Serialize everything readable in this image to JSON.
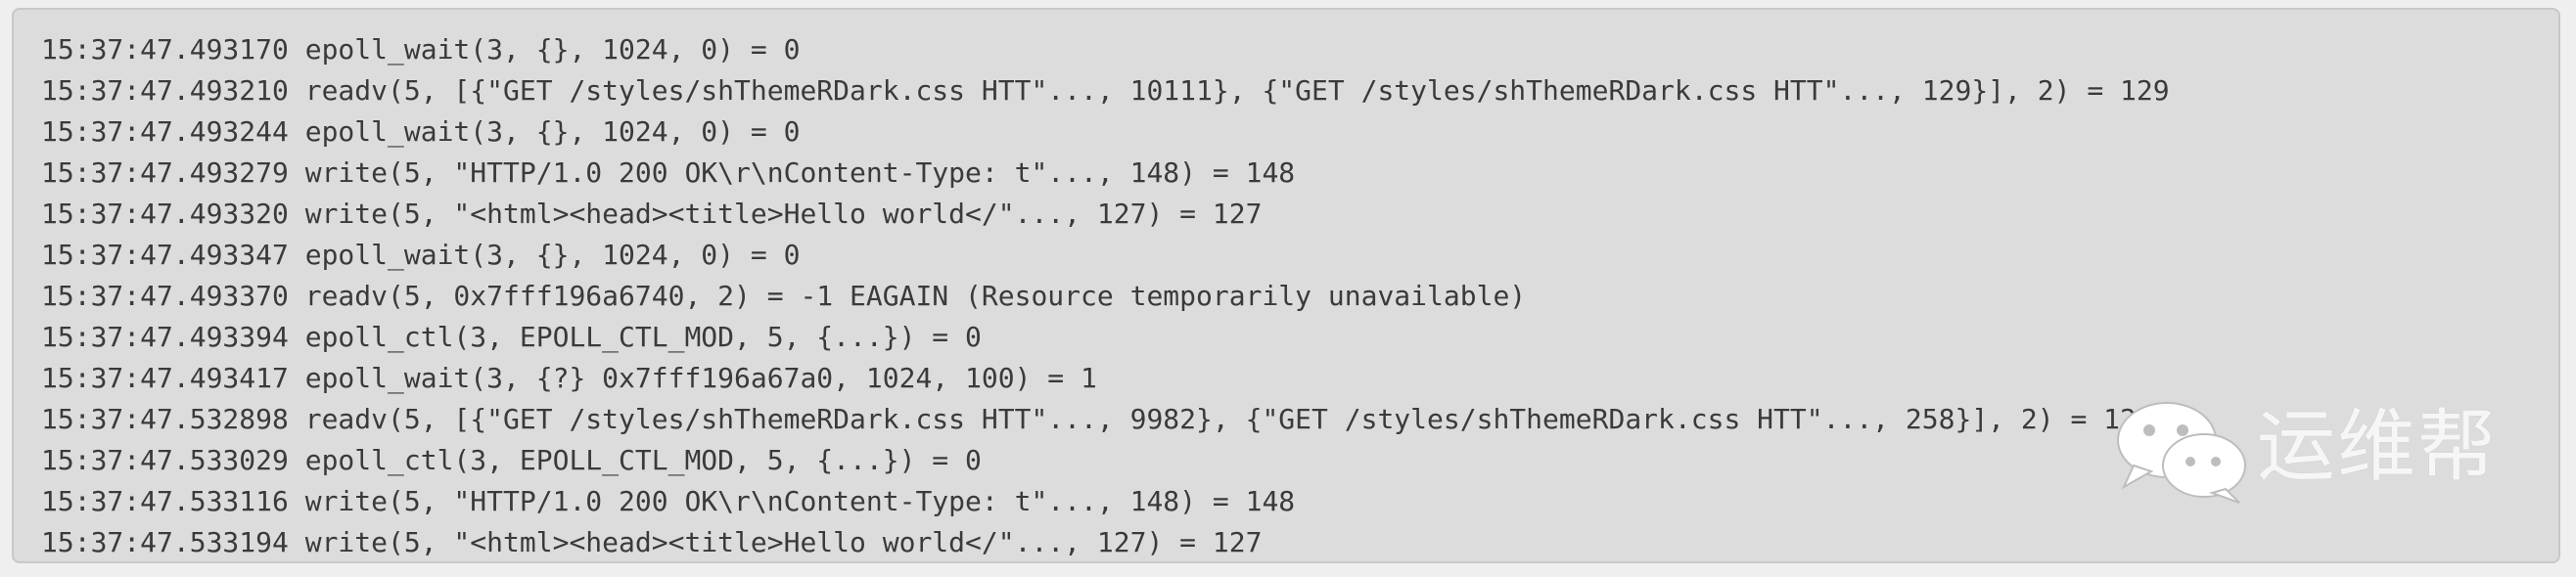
{
  "log": {
    "lines": [
      "15:37:47.493170 epoll_wait(3, {}, 1024, 0) = 0",
      "15:37:47.493210 readv(5, [{\"GET /styles/shThemeRDark.css HTT\"..., 10111}, {\"GET /styles/shThemeRDark.css HTT\"..., 129}], 2) = 129",
      "15:37:47.493244 epoll_wait(3, {}, 1024, 0) = 0",
      "15:37:47.493279 write(5, \"HTTP/1.0 200 OK\\r\\nContent-Type: t\"..., 148) = 148",
      "15:37:47.493320 write(5, \"<html><head><title>Hello world</\"..., 127) = 127",
      "15:37:47.493347 epoll_wait(3, {}, 1024, 0) = 0",
      "15:37:47.493370 readv(5, 0x7fff196a6740, 2) = -1 EAGAIN (Resource temporarily unavailable)",
      "15:37:47.493394 epoll_ctl(3, EPOLL_CTL_MOD, 5, {...}) = 0",
      "15:37:47.493417 epoll_wait(3, {?} 0x7fff196a67a0, 1024, 100) = 1",
      "15:37:47.532898 readv(5, [{\"GET /styles/shThemeRDark.css HTT\"..., 9982}, {\"GET /styles/shThemeRDark.css HTT\"..., 258}], 2) = 129",
      "15:37:47.533029 epoll_ctl(3, EPOLL_CTL_MOD, 5, {...}) = 0",
      "15:37:47.533116 write(5, \"HTTP/1.0 200 OK\\r\\nContent-Type: t\"..., 148) = 148",
      "15:37:47.533194 write(5, \"<html><head><title>Hello world</\"..., 127) = 127"
    ]
  },
  "watermark": {
    "text": "运维帮",
    "icon": "wechat-icon"
  },
  "colors": {
    "panel_background": "#dcdcdc",
    "page_background": "#efefef",
    "text": "#3a3a3a",
    "watermark": "#ffffff"
  }
}
